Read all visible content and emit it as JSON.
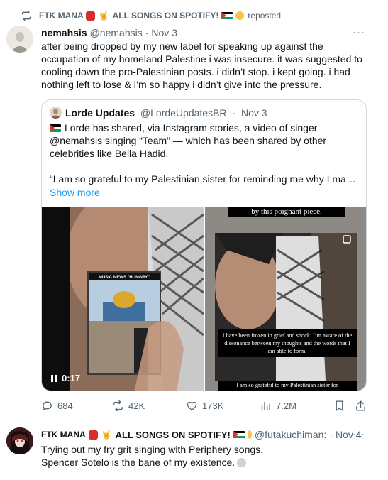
{
  "repost": {
    "reposter_name": "FTK MANA",
    "reposter_tail": "ALL SONGS ON SPOTIFY!",
    "label": "reposted"
  },
  "tweet": {
    "name": "nemahsis",
    "handle": "@nemahsis",
    "separator": "·",
    "time": "Nov 3",
    "more": "···",
    "text": "after being dropped by my new label for speaking up against the occupation of my homeland Palestine i was insecure. it was suggested to cooling down the pro-Palestinian posts. i didn’t stop. i kept going. i had nothing left to lose & i’m so happy i didn’t give into the pressure.",
    "quote": {
      "name": "Lorde Updates",
      "handle": "@LordeUpdatesBR",
      "separator": "·",
      "time": "Nov 3",
      "text1": "Lorde has shared, via Instagram stories, a video of singer @nemahsis singing “Team” — which has been shared by other celebrities like Bella Hadid.",
      "text2": "“I am so grateful to my Palestinian sister for reminding me why I make...",
      "show_more": "Show more",
      "media": {
        "left_overlay_caption": "MUSIC NEWS \"HUNGRY\"",
        "video_time": "0:17",
        "right_top_caption": "by this poignant piece.",
        "right_mid_caption": "I have been frozen in grief and shock. I’m aware of the dissonance between my thoughts and the words that I am able to form.",
        "right_bottom_caption": "I am so grateful to my Palestinian sister for"
      }
    },
    "actions": {
      "replies": "684",
      "reposts": "42K",
      "likes": "173K",
      "views": "7.2M"
    }
  },
  "tweet2": {
    "name": "FTK MANA",
    "name_tail": "ALL SONGS ON SPOTIFY!",
    "handle": "@futakuchiman:",
    "separator": "·",
    "time": "Nov 4",
    "more": "···",
    "line1": "Trying out my fry grit singing with Periphery songs.",
    "line2": "Spencer Sotelo is the bane of my existence."
  },
  "colors": {
    "text": "#0f1419",
    "secondary": "#536471",
    "link": "#1d9bf0",
    "border": "#cfd9de"
  }
}
